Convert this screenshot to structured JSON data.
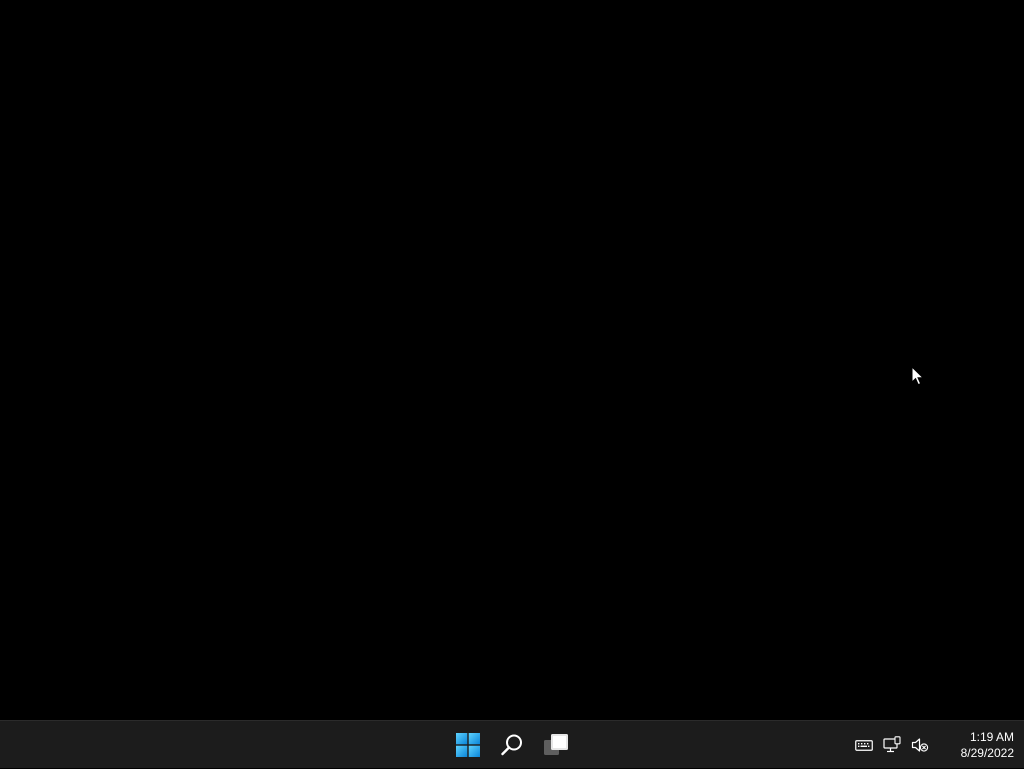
{
  "desktop": {
    "background_color": "#000000"
  },
  "taskbar": {
    "background_color": "#1c1c1c",
    "pinned": [
      {
        "name": "start",
        "icon": "windows-logo-icon"
      },
      {
        "name": "search",
        "icon": "search-icon"
      },
      {
        "name": "task-view",
        "icon": "task-view-icon"
      }
    ],
    "tray": {
      "icons": [
        "keyboard-icon",
        "network-icon",
        "volume-muted-icon"
      ],
      "time": "1:19 AM",
      "date": "8/29/2022"
    }
  }
}
